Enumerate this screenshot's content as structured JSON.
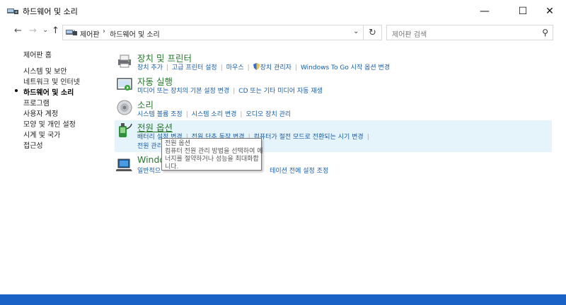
{
  "window": {
    "title": "하드웨어 및 소리",
    "controls": {
      "minimize": "—",
      "maximize": "☐",
      "close": "✕"
    }
  },
  "nav": {
    "back": "←",
    "forward": "→",
    "recent": "⌄",
    "up": "↑",
    "breadcrumbs": [
      "제어판",
      "하드웨어 및 소리"
    ],
    "separator": "›",
    "dropdown": "⌄",
    "refresh": "↻",
    "search_placeholder": "제어판 검색",
    "search_icon": "⚲"
  },
  "sidebar": {
    "home": "제어판 홈",
    "items": [
      {
        "label": "시스템 및 보안",
        "active": false
      },
      {
        "label": "네트워크 및 인터넷",
        "active": false
      },
      {
        "label": "하드웨어 및 소리",
        "active": true
      },
      {
        "label": "프로그램",
        "active": false
      },
      {
        "label": "사용자 계정",
        "active": false
      },
      {
        "label": "모양 및 개인 설정",
        "active": false
      },
      {
        "label": "시계 및 국가",
        "active": false
      },
      {
        "label": "접근성",
        "active": false
      }
    ]
  },
  "categories": [
    {
      "title": "장치 및 프린터",
      "icon": "printer-icon",
      "links": [
        "장치 추가",
        "고급 프린터 설정",
        "마우스",
        "장치 관리자",
        "Windows To Go 시작 옵션 변경"
      ]
    },
    {
      "title": "자동 실행",
      "icon": "autoplay-icon",
      "links": [
        "미디어 또는 장치의 기본 설정 변경",
        "CD 또는 기타 미디어 자동 재생"
      ]
    },
    {
      "title": "소리",
      "icon": "speaker-icon",
      "links": [
        "시스템 볼륨 조정",
        "시스템 소리 변경",
        "오디오 장치 관리"
      ]
    },
    {
      "title": "전원 옵션",
      "icon": "power-options-icon",
      "links": [
        "배터리 설정 변경",
        "전원 단추 동작 변경",
        "컴퓨터가 절전 모드로 전환되는 시기 변경"
      ],
      "links2": [
        "전원 관리"
      ]
    },
    {
      "title": "Windo",
      "icon": "windows-mobility-icon",
      "links": [
        "일반적으",
        "테이션 전에 설정 조정"
      ]
    }
  ],
  "tooltip": {
    "lines": [
      "전원 옵션",
      "컴퓨터 전원 관리 방법을 선택하여 에",
      "너지를 절약하거나 성능을 최대화합",
      "니다."
    ]
  },
  "colors": {
    "link": "#1a5ea8",
    "category_title": "#267a2b",
    "highlight": "#e5f3fb",
    "desktop": "#1f6ed3"
  }
}
